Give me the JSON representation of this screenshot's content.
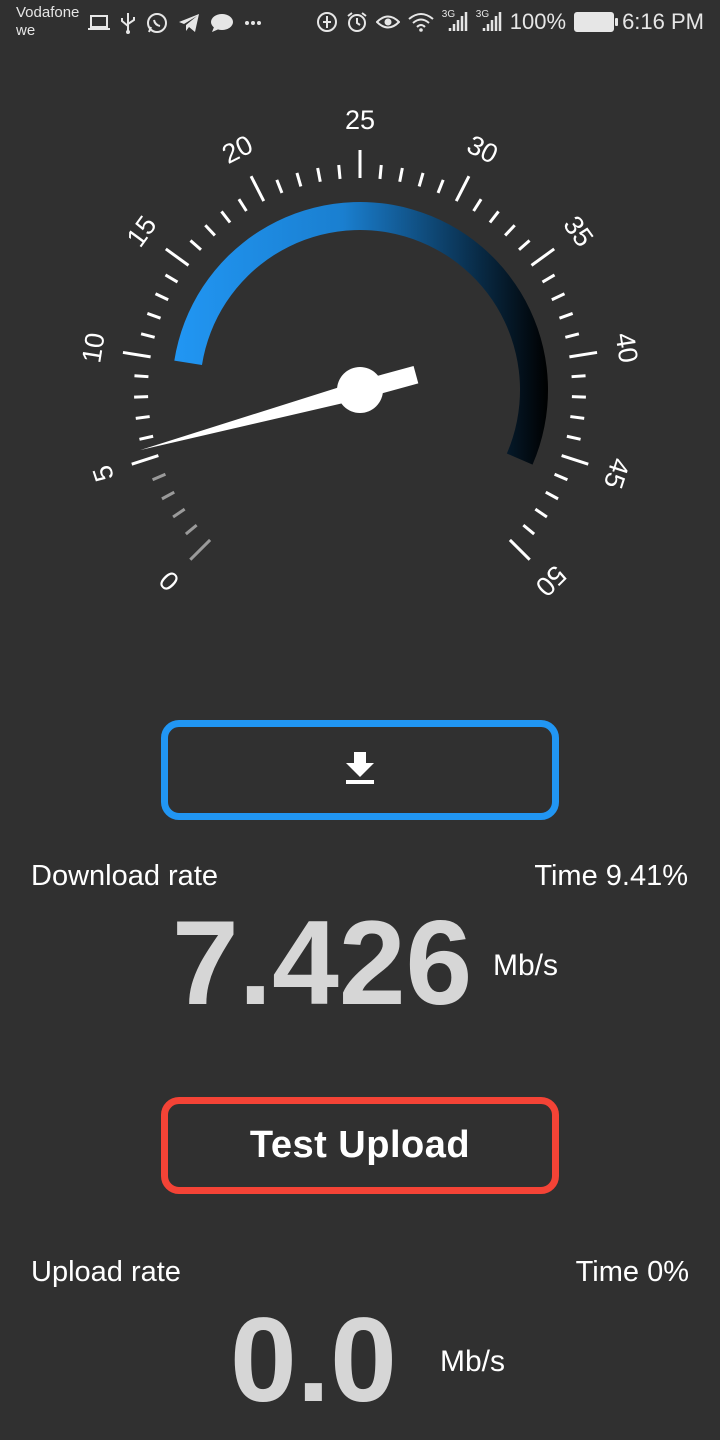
{
  "status_bar": {
    "carrier_line1": "Vodafone",
    "carrier_line2": "we",
    "net1": "3G",
    "net2": "3G",
    "battery": "100%",
    "time": "6:16 PM",
    "icons": [
      "laptop-icon",
      "usb-icon",
      "whatsapp-icon",
      "telegram-icon",
      "chat-icon",
      "more-icon",
      "data-saver-icon",
      "alarm-icon",
      "eye-icon",
      "wifi-icon",
      "signal-icon",
      "battery-icon"
    ]
  },
  "gauge": {
    "min": 0,
    "max": 50,
    "tick_labels": [
      "0",
      "5",
      "10",
      "15",
      "20",
      "25",
      "30",
      "35",
      "40",
      "45",
      "50"
    ],
    "needle_value": 5.5,
    "arc_start": 10,
    "arc_end": 46,
    "colors": {
      "arc_start": "#2196f3",
      "arc_end": "#000000"
    }
  },
  "download": {
    "label": "Download rate",
    "time": "Time 9.41%",
    "value": "7.426",
    "unit": "Mb/s",
    "button_icon": "download-icon"
  },
  "upload": {
    "button_label": "Test Upload",
    "label": "Upload rate",
    "time": "Time 0%",
    "value": "0.0",
    "unit": "Mb/s"
  },
  "colors": {
    "background": "#303030",
    "download_border": "#2196f3",
    "upload_border": "#f44336",
    "value_text": "#d6d6d6"
  }
}
